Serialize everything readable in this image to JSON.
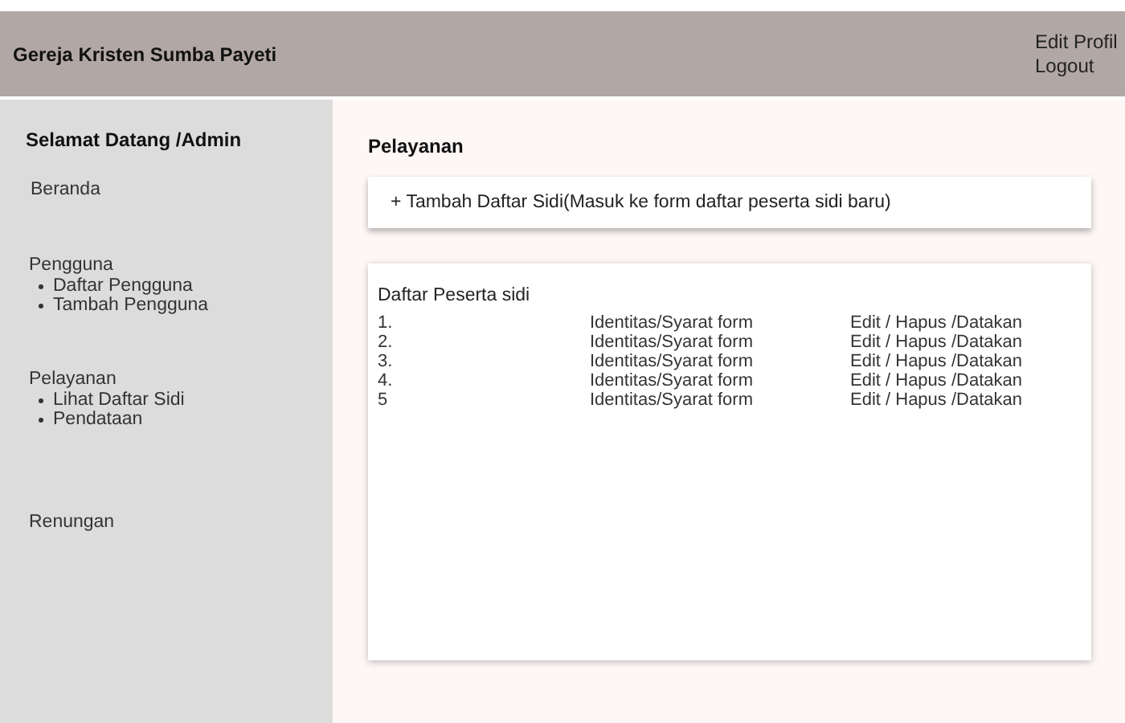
{
  "header": {
    "title": "Gereja Kristen Sumba Payeti",
    "links": [
      "Edit Profil",
      "Logout"
    ]
  },
  "sidebar": {
    "greeting": "Selamat Datang /Admin",
    "sections": [
      {
        "label": "Beranda"
      },
      {
        "label": "Pengguna",
        "children": [
          "Daftar Pengguna",
          "Tambah Pengguna"
        ]
      },
      {
        "label": "Pelayanan",
        "children": [
          "Lihat Daftar Sidi",
          "Pendataan"
        ]
      },
      {
        "label": "Renungan"
      }
    ]
  },
  "main": {
    "title": "Pelayanan",
    "add_action": "+ Tambah Daftar Sidi(Masuk ke form daftar peserta sidi baru)",
    "list": {
      "title": "Daftar Peserta sidi",
      "rows": [
        {
          "number": "1.",
          "form": "Identitas/Syarat form",
          "actions": "Edit / Hapus /Datakan"
        },
        {
          "number": "2.",
          "form": "Identitas/Syarat form",
          "actions": "Edit / Hapus /Datakan"
        },
        {
          "number": "3.",
          "form": "Identitas/Syarat form",
          "actions": "Edit / Hapus /Datakan"
        },
        {
          "number": "4.",
          "form": "Identitas/Syarat form",
          "actions": "Edit / Hapus /Datakan"
        },
        {
          "number": "5",
          "form": "Identitas/Syarat form",
          "actions": "Edit / Hapus /Datakan"
        }
      ]
    }
  }
}
